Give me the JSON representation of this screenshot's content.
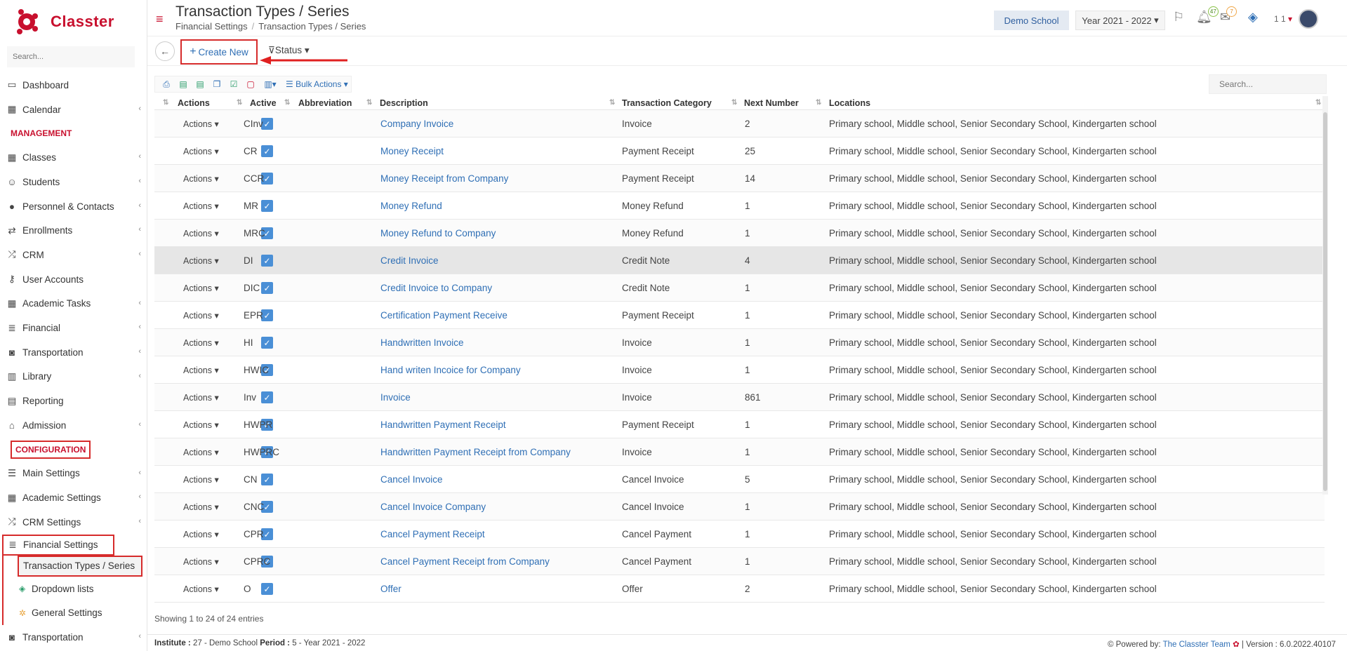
{
  "app": {
    "name": "Classter",
    "brand_color": "#c8102e",
    "link_color": "#2f6fb5"
  },
  "sidebar": {
    "search_placeholder": "Search...",
    "items": [
      {
        "label": "Dashboard",
        "icon": "laptop-icon"
      },
      {
        "label": "Calendar",
        "icon": "calendar-icon"
      }
    ],
    "management_header": "MANAGEMENT",
    "management_items": [
      {
        "label": "Classes"
      },
      {
        "label": "Students"
      },
      {
        "label": "Personnel & Contacts"
      },
      {
        "label": "Enrollments"
      },
      {
        "label": "CRM"
      },
      {
        "label": "User Accounts"
      },
      {
        "label": "Academic Tasks"
      },
      {
        "label": "Financial"
      },
      {
        "label": "Transportation"
      },
      {
        "label": "Library"
      },
      {
        "label": "Reporting"
      },
      {
        "label": "Admission"
      }
    ],
    "configuration_header": "CONFIGURATION",
    "configuration_items": [
      {
        "label": "Main Settings"
      },
      {
        "label": "Academic Settings"
      },
      {
        "label": "CRM Settings"
      },
      {
        "label": "Financial Settings"
      }
    ],
    "financial_sub": [
      {
        "label": "Transaction Types / Series"
      },
      {
        "label": "Dropdown lists"
      },
      {
        "label": "General Settings"
      }
    ],
    "last_item": "Transportation"
  },
  "header": {
    "title": "Transaction Types / Series",
    "breadcrumb": [
      "Financial Settings",
      "Transaction Types / Series"
    ],
    "school": "Demo School",
    "year": "Year 2021 - 2022",
    "notifications_count": "47",
    "messages_count": "7",
    "user_label": "1 1"
  },
  "toolbar": {
    "create_label": "Create New",
    "status_label": "Status",
    "bulk_label": "Bulk Actions",
    "search_placeholder": "Search..."
  },
  "table": {
    "columns": [
      "Actions",
      "Active",
      "Abbreviation",
      "Description",
      "Transaction Category",
      "Next Number",
      "Locations"
    ],
    "action_label": "Actions",
    "rows": [
      {
        "abbr": "CInv",
        "desc": "Company Invoice",
        "cat": "Invoice",
        "next": "2",
        "loc": "Primary school, Middle school, Senior Secondary School, Kindergarten school"
      },
      {
        "abbr": "CR",
        "desc": "Money Receipt",
        "cat": "Payment Receipt",
        "next": "25",
        "loc": "Primary school, Middle school, Senior Secondary School, Kindergarten school"
      },
      {
        "abbr": "CCR",
        "desc": "Money Receipt from Company",
        "cat": "Payment Receipt",
        "next": "14",
        "loc": "Primary school, Middle school, Senior Secondary School, Kindergarten school"
      },
      {
        "abbr": "MR",
        "desc": "Money Refund",
        "cat": "Money Refund",
        "next": "1",
        "loc": "Primary school, Middle school, Senior Secondary School, Kindergarten school"
      },
      {
        "abbr": "MRC",
        "desc": "Money Refund to Company",
        "cat": "Money Refund",
        "next": "1",
        "loc": "Primary school, Middle school, Senior Secondary School, Kindergarten school"
      },
      {
        "abbr": "DI",
        "desc": "Credit Invoice",
        "cat": "Credit Note",
        "next": "4",
        "loc": "Primary school, Middle school, Senior Secondary School, Kindergarten school"
      },
      {
        "abbr": "DIC",
        "desc": "Credit Invoice to Company",
        "cat": "Credit Note",
        "next": "1",
        "loc": "Primary school, Middle school, Senior Secondary School, Kindergarten school"
      },
      {
        "abbr": "EPR",
        "desc": "Certification Payment Receive",
        "cat": "Payment Receipt",
        "next": "1",
        "loc": "Primary school, Middle school, Senior Secondary School, Kindergarten school"
      },
      {
        "abbr": "HI",
        "desc": "Handwritten Invoice",
        "cat": "Invoice",
        "next": "1",
        "loc": "Primary school, Middle school, Senior Secondary School, Kindergarten school"
      },
      {
        "abbr": "HWIC",
        "desc": "Hand writen Incoice for Company",
        "cat": "Invoice",
        "next": "1",
        "loc": "Primary school, Middle school, Senior Secondary School, Kindergarten school"
      },
      {
        "abbr": "Inv",
        "desc": "Invoice",
        "cat": "Invoice",
        "next": "861",
        "loc": "Primary school, Middle school, Senior Secondary School, Kindergarten school"
      },
      {
        "abbr": "HWPR",
        "desc": "Handwritten Payment Receipt",
        "cat": "Payment Receipt",
        "next": "1",
        "loc": "Primary school, Middle school, Senior Secondary School, Kindergarten school"
      },
      {
        "abbr": "HWPRC",
        "desc": "Handwritten Payment Receipt from Company",
        "cat": "Invoice",
        "next": "1",
        "loc": "Primary school, Middle school, Senior Secondary School, Kindergarten school"
      },
      {
        "abbr": "CN",
        "desc": "Cancel Invoice",
        "cat": "Cancel Invoice",
        "next": "5",
        "loc": "Primary school, Middle school, Senior Secondary School, Kindergarten school"
      },
      {
        "abbr": "CNC",
        "desc": "Cancel Invoice Company",
        "cat": "Cancel Invoice",
        "next": "1",
        "loc": "Primary school, Middle school, Senior Secondary School, Kindergarten school"
      },
      {
        "abbr": "CPR",
        "desc": "Cancel Payment Receipt",
        "cat": "Cancel Payment",
        "next": "1",
        "loc": "Primary school, Middle school, Senior Secondary School, Kindergarten school"
      },
      {
        "abbr": "CPRC",
        "desc": "Cancel Payment Receipt from Company",
        "cat": "Cancel Payment",
        "next": "1",
        "loc": "Primary school, Middle school, Senior Secondary School, Kindergarten school"
      },
      {
        "abbr": "O",
        "desc": "Offer",
        "cat": "Offer",
        "next": "2",
        "loc": "Primary school, Middle school, Senior Secondary School, Kindergarten school"
      }
    ]
  },
  "showing": "Showing 1 to 24 of 24 entries",
  "footer": {
    "institute_label": "Institute :",
    "institute_value": "27 - Demo School",
    "period_label": "Period :",
    "period_value": "5 - Year 2021 - 2022",
    "powered_label": "Powered by:",
    "powered_link": "The Classter Team",
    "version": "| Version : 6.0.2022.40107"
  }
}
